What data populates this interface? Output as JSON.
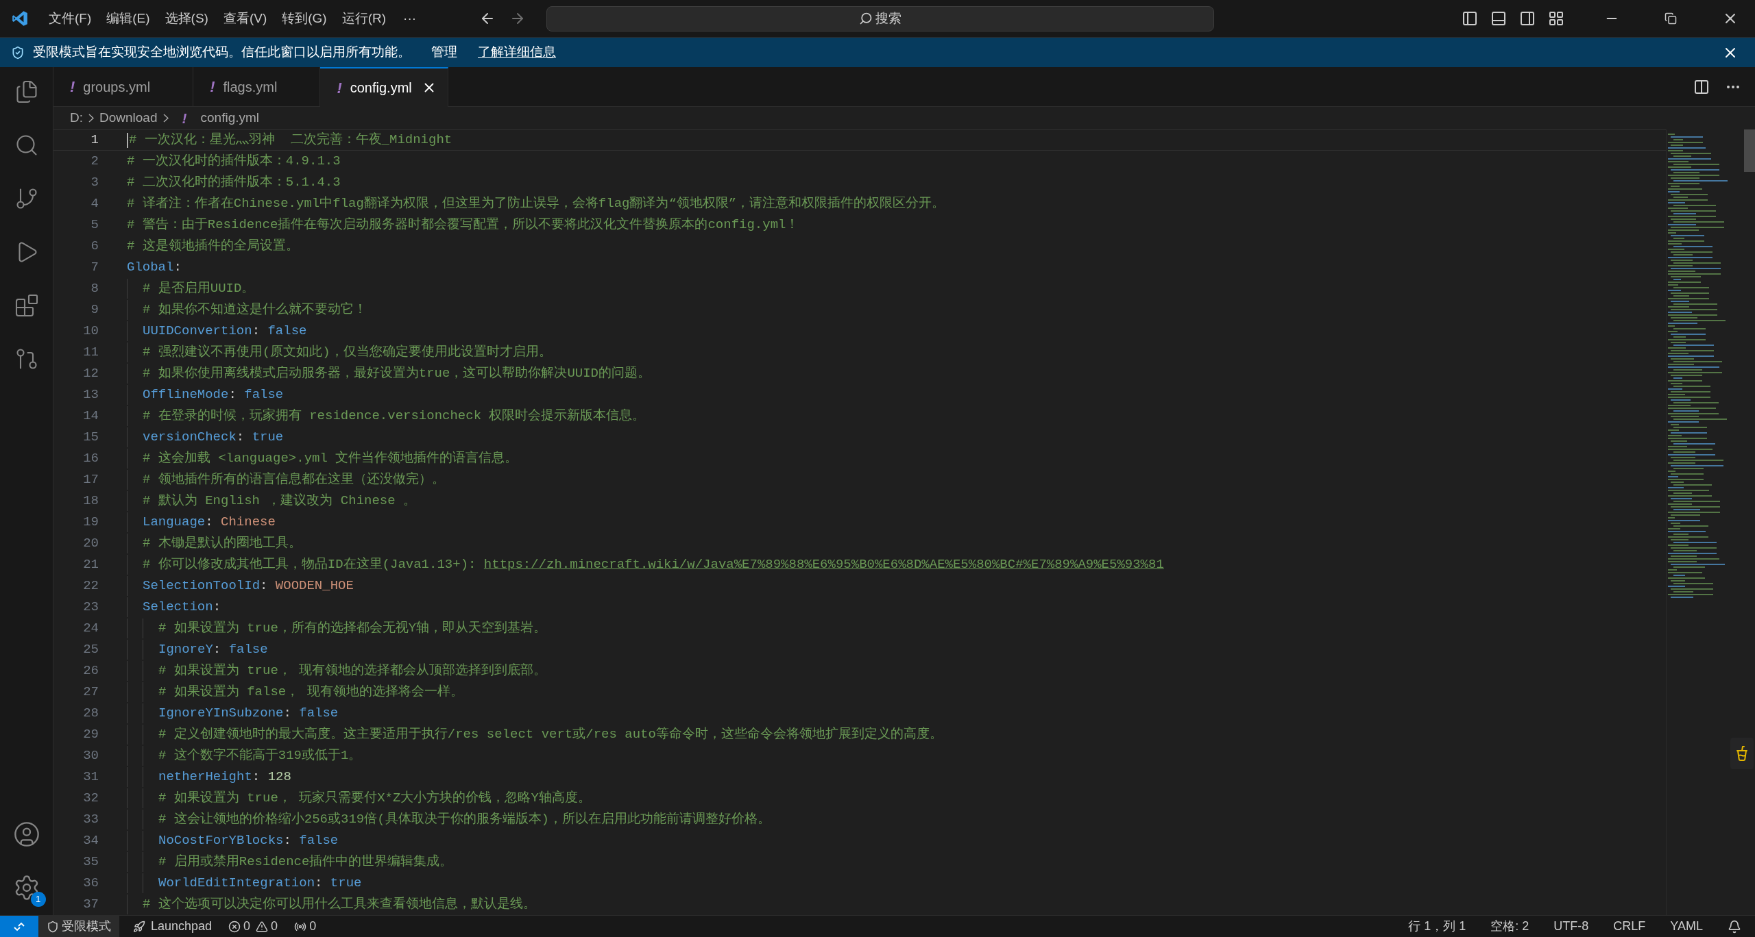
{
  "title_bar": {
    "menus": [
      "文件(F)",
      "编辑(E)",
      "选择(S)",
      "查看(V)",
      "转到(G)",
      "运行(R)"
    ],
    "more": "···",
    "search": {
      "placeholder": "搜索"
    }
  },
  "banner": {
    "message": "受限模式旨在实现安全地浏览代码。信任此窗口以启用所有功能。",
    "links": [
      "管理",
      "了解详细信息"
    ]
  },
  "activity_bar": {
    "settings_badge": "1"
  },
  "tabs": [
    {
      "label": "groups.yml",
      "icon": "!",
      "selected": false
    },
    {
      "label": "flags.yml",
      "icon": "!",
      "selected": false
    },
    {
      "label": "config.yml",
      "icon": "!",
      "selected": true
    }
  ],
  "breadcrumb": {
    "parts": [
      "D:",
      "Download"
    ],
    "file": {
      "icon": "!",
      "label": "config.yml"
    }
  },
  "editor": {
    "lines": [
      {
        "number": "1",
        "active": true,
        "tokens": [
          {
            "kind": "comment",
            "text": "# 一次汉化：星光灬羽神  二次完善：午夜_Midnight"
          }
        ]
      },
      {
        "number": "2",
        "active": false,
        "tokens": [
          {
            "kind": "comment",
            "text": "# 一次汉化时的插件版本：4.9.1.3"
          }
        ]
      },
      {
        "number": "3",
        "active": false,
        "tokens": [
          {
            "kind": "comment",
            "text": "# 二次汉化时的插件版本：5.1.4.3"
          }
        ]
      },
      {
        "number": "4",
        "active": false,
        "tokens": [
          {
            "kind": "comment",
            "text": "# 译者注：作者在Chinese.yml中flag翻译为权限，但这里为了防止误导，会将flag翻译为“领地权限”，请注意和权限插件的权限区分开。"
          }
        ]
      },
      {
        "number": "5",
        "active": false,
        "tokens": [
          {
            "kind": "comment",
            "text": "# 警告：由于Residence插件在每次启动服务器时都会覆写配置，所以不要将此汉化文件替换原本的config.yml！"
          }
        ]
      },
      {
        "number": "6",
        "active": false,
        "tokens": [
          {
            "kind": "comment",
            "text": "# 这是领地插件的全局设置。"
          }
        ]
      },
      {
        "number": "7",
        "active": false,
        "tokens": [
          {
            "kind": "key",
            "text": "Global"
          },
          {
            "kind": "punct",
            "text": ":"
          }
        ],
        "children": [
          {
            "number": "8",
            "active": false,
            "tokens": [
              {
                "kind": "comment",
                "text": "# 是否启用UUID。"
              }
            ]
          },
          {
            "number": "9",
            "active": false,
            "tokens": [
              {
                "kind": "comment",
                "text": "# 如果你不知道这是什么就不要动它！"
              }
            ]
          },
          {
            "number": "10",
            "active": false,
            "tokens": [
              {
                "kind": "key",
                "text": "UUIDConvertion"
              },
              {
                "kind": "punct",
                "text": ": "
              },
              {
                "kind": "bool",
                "text": "false"
              }
            ]
          },
          {
            "number": "11",
            "active": false,
            "tokens": [
              {
                "kind": "comment",
                "text": "# 强烈建议不再使用(原文如此)，仅当您确定要使用此设置时才启用。"
              }
            ]
          },
          {
            "number": "12",
            "active": false,
            "tokens": [
              {
                "kind": "comment",
                "text": "# 如果你使用离线模式启动服务器，最好设置为true，这可以帮助你解决UUID的问题。"
              }
            ]
          },
          {
            "number": "13",
            "active": false,
            "tokens": [
              {
                "kind": "key",
                "text": "OfflineMode"
              },
              {
                "kind": "punct",
                "text": ": "
              },
              {
                "kind": "bool",
                "text": "false"
              }
            ]
          },
          {
            "number": "14",
            "active": false,
            "tokens": [
              {
                "kind": "comment",
                "text": "# 在登录的时候，玩家拥有 residence.versioncheck 权限时会提示新版本信息。"
              }
            ]
          },
          {
            "number": "15",
            "active": false,
            "tokens": [
              {
                "kind": "key",
                "text": "versionCheck"
              },
              {
                "kind": "punct",
                "text": ": "
              },
              {
                "kind": "bool",
                "text": "true"
              }
            ]
          },
          {
            "number": "16",
            "active": false,
            "tokens": [
              {
                "kind": "comment",
                "text": "# 这会加载 <language>.yml 文件当作领地插件的语言信息。"
              }
            ]
          },
          {
            "number": "17",
            "active": false,
            "tokens": [
              {
                "kind": "comment",
                "text": "# 领地插件所有的语言信息都在这里（还没做完）。"
              }
            ]
          },
          {
            "number": "18",
            "active": false,
            "tokens": [
              {
                "kind": "comment",
                "text": "# 默认为 English ，建议改为 Chinese 。"
              }
            ]
          },
          {
            "number": "19",
            "active": false,
            "tokens": [
              {
                "kind": "key",
                "text": "Language"
              },
              {
                "kind": "punct",
                "text": ": "
              },
              {
                "kind": "string",
                "text": "Chinese"
              }
            ]
          },
          {
            "number": "20",
            "active": false,
            "tokens": [
              {
                "kind": "comment",
                "text": "# 木锄是默认的圈地工具。"
              }
            ]
          },
          {
            "number": "21",
            "active": false,
            "tokens": [
              {
                "kind": "comment",
                "text": "# 你可以修改成其他工具，物品ID在这里(Java1.13+): "
              },
              {
                "kind": "link",
                "text": "https://zh.minecraft.wiki/w/Java%E7%89%88%E6%95%B0%E6%8D%AE%E5%80%BC#%E7%89%A9%E5%93%81"
              }
            ]
          },
          {
            "number": "22",
            "active": false,
            "tokens": [
              {
                "kind": "key",
                "text": "SelectionToolId"
              },
              {
                "kind": "punct",
                "text": ": "
              },
              {
                "kind": "string",
                "text": "WOODEN_HOE"
              }
            ]
          },
          {
            "number": "23",
            "active": false,
            "tokens": [
              {
                "kind": "key",
                "text": "Selection"
              },
              {
                "kind": "punct",
                "text": ":"
              }
            ],
            "children": [
              {
                "number": "24",
                "active": false,
                "tokens": [
                  {
                    "kind": "comment",
                    "text": "# 如果设置为 true，所有的选择都会无视Y轴，即从天空到基岩。"
                  }
                ]
              },
              {
                "number": "25",
                "active": false,
                "tokens": [
                  {
                    "kind": "key",
                    "text": "IgnoreY"
                  },
                  {
                    "kind": "punct",
                    "text": ": "
                  },
                  {
                    "kind": "bool",
                    "text": "false"
                  }
                ]
              },
              {
                "number": "26",
                "active": false,
                "tokens": [
                  {
                    "kind": "comment",
                    "text": "# 如果设置为 true， 现有领地的选择都会从顶部选择到到底部。"
                  }
                ]
              },
              {
                "number": "27",
                "active": false,
                "tokens": [
                  {
                    "kind": "comment",
                    "text": "# 如果设置为 false， 现有领地的选择将会一样。"
                  }
                ]
              },
              {
                "number": "28",
                "active": false,
                "tokens": [
                  {
                    "kind": "key",
                    "text": "IgnoreYInSubzone"
                  },
                  {
                    "kind": "punct",
                    "text": ": "
                  },
                  {
                    "kind": "bool",
                    "text": "false"
                  }
                ]
              },
              {
                "number": "29",
                "active": false,
                "tokens": [
                  {
                    "kind": "comment",
                    "text": "# 定义创建领地时的最大高度。这主要适用于执行/res select vert或/res auto等命令时，这些命令会将领地扩展到定义的高度。"
                  }
                ]
              },
              {
                "number": "30",
                "active": false,
                "tokens": [
                  {
                    "kind": "comment",
                    "text": "# 这个数字不能高于319或低于1。"
                  }
                ]
              },
              {
                "number": "31",
                "active": false,
                "tokens": [
                  {
                    "kind": "key",
                    "text": "netherHeight"
                  },
                  {
                    "kind": "punct",
                    "text": ": "
                  },
                  {
                    "kind": "number",
                    "text": "128"
                  }
                ]
              },
              {
                "number": "32",
                "active": false,
                "tokens": [
                  {
                    "kind": "comment",
                    "text": "# 如果设置为 true， 玩家只需要付X*Z大小方块的价钱，忽略Y轴高度。"
                  }
                ]
              },
              {
                "number": "33",
                "active": false,
                "tokens": [
                  {
                    "kind": "comment",
                    "text": "# 这会让领地的价格缩小256或319倍(具体取决于你的服务端版本)，所以在启用此功能前请调整好价格。"
                  }
                ]
              },
              {
                "number": "34",
                "active": false,
                "tokens": [
                  {
                    "kind": "key",
                    "text": "NoCostForYBlocks"
                  },
                  {
                    "kind": "punct",
                    "text": ": "
                  },
                  {
                    "kind": "bool",
                    "text": "false"
                  }
                ]
              },
              {
                "number": "35",
                "active": false,
                "tokens": [
                  {
                    "kind": "comment",
                    "text": "# 启用或禁用Residence插件中的世界编辑集成。"
                  }
                ]
              },
              {
                "number": "36",
                "active": false,
                "tokens": [
                  {
                    "kind": "key",
                    "text": "WorldEditIntegration"
                  },
                  {
                    "kind": "punct",
                    "text": ": "
                  },
                  {
                    "kind": "bool",
                    "text": "true"
                  }
                ]
              }
            ]
          },
          {
            "number": "37",
            "active": false,
            "tokens": [
              {
                "kind": "comment",
                "text": "# 这个选项可以决定你可以用什么工具来查看领地信息，默认是线。"
              }
            ]
          }
        ]
      }
    ]
  },
  "status_bar": {
    "restricted": "受限模式",
    "launchpad": "Launchpad",
    "errors": "0",
    "warnings": "0",
    "ports": "0",
    "right": [
      "行 1，列 1",
      "空格: 2",
      "UTF-8",
      "CRLF",
      "YAML"
    ]
  }
}
